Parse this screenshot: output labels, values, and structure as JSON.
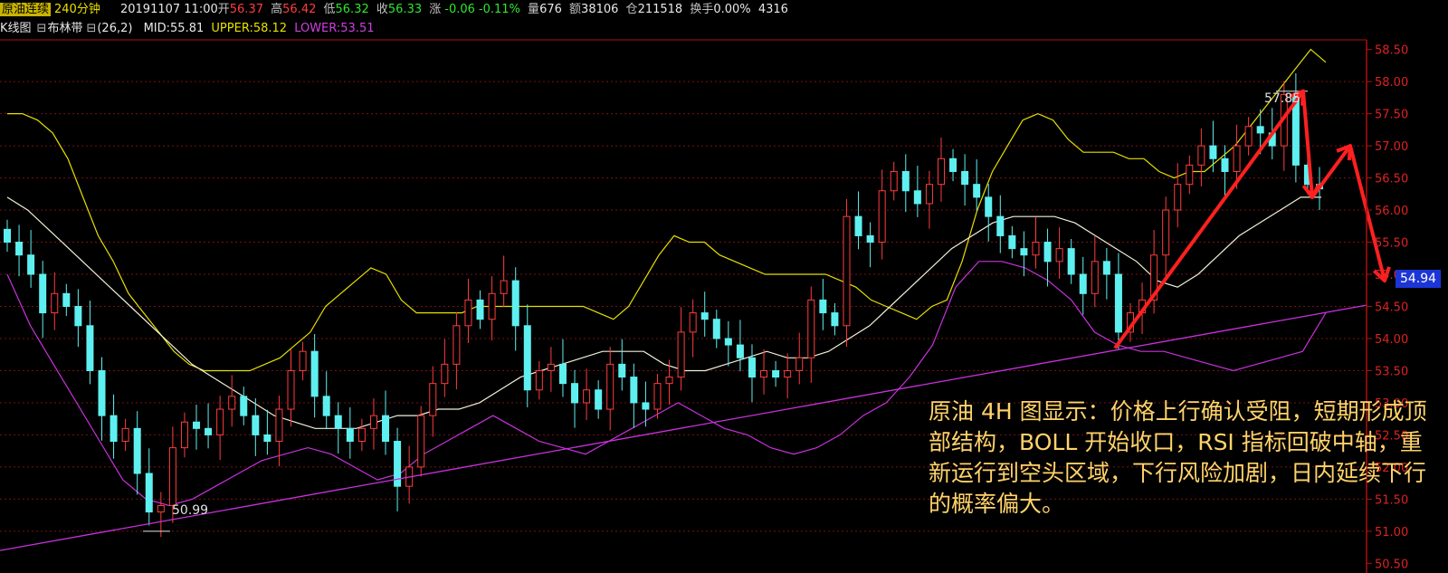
{
  "header": {
    "instrument": "原油连续",
    "period": "240分钟",
    "datetime": "20191107 11:00",
    "open_label": "开",
    "open": "56.37",
    "high_label": "高",
    "high": "56.42",
    "low_label": "低",
    "low": "56.32",
    "close_label": "收",
    "close": "56.33",
    "change_label": "涨",
    "change": "-0.06",
    "change_pct": "-0.11%",
    "volume_label": "量",
    "volume": "676",
    "amount_label": "额",
    "amount": "38106",
    "oi_label": "仓",
    "oi": "211518",
    "turnover_label": "换手",
    "turnover": "0.00%",
    "extra": "4316"
  },
  "indicator_bar": {
    "kline": "K线图",
    "boll_name": "布林带",
    "params": "(26,2)",
    "mid": "MID:55.81",
    "upper": "UPPER:58.12",
    "lower": "LOWER:53.51",
    "icon_box": "⊟"
  },
  "colors": {
    "up": "#ff3c3c",
    "down": "#5ef0f0",
    "mid": "#f0f0d8",
    "upper": "#e6e000",
    "lower": "#c832dc",
    "grid": "#7a1010",
    "axis": "#b01010",
    "arrow": "#ff2020",
    "annotation": "#ffd36a"
  },
  "annotation": {
    "text": "原油 4H 图显示：价格上行确认受阻，短期形成顶部结构，BOLL 开始收口，RSI 指标回破中轴，重新运行到空头区域，下行风险加剧，日内延续下行的概率偏大。"
  },
  "price_tag": "54.94",
  "chart_data": {
    "type": "candlestick",
    "title": "原油连续 240分钟",
    "y_axis_ticks": [
      "58.50",
      "58.00",
      "57.50",
      "57.00",
      "56.50",
      "56.00",
      "55.50",
      "55.00",
      "54.50",
      "54.00",
      "53.50",
      "53.00",
      "52.50",
      "52.00",
      "51.50",
      "51.00",
      "50.50"
    ],
    "ylim": [
      50.35,
      58.65
    ],
    "low_marker": "50.99",
    "high_marker": "57.85",
    "current_price": "54.94",
    "indicator": {
      "name": "BOLL",
      "params": "(26,2)",
      "MID": 55.81,
      "UPPER": 58.12,
      "LOWER": 53.51
    },
    "close_path": [
      55.5,
      55.3,
      55.0,
      54.4,
      54.7,
      54.5,
      54.2,
      53.5,
      52.8,
      52.4,
      52.6,
      51.9,
      51.3,
      51.4,
      52.3,
      52.7,
      52.6,
      52.5,
      52.9,
      53.1,
      52.8,
      52.5,
      52.4,
      52.9,
      53.5,
      53.8,
      53.1,
      52.8,
      52.6,
      52.4,
      52.6,
      52.8,
      52.4,
      51.7,
      52.0,
      52.8,
      53.3,
      53.6,
      54.2,
      54.6,
      54.3,
      54.7,
      54.9,
      54.2,
      53.2,
      53.5,
      53.6,
      53.3,
      53.0,
      53.2,
      52.9,
      53.6,
      53.4,
      53.0,
      52.9,
      53.3,
      53.4,
      54.1,
      54.4,
      54.3,
      54.0,
      53.9,
      53.7,
      53.4,
      53.5,
      53.4,
      53.5,
      53.7,
      54.6,
      54.4,
      54.2,
      55.9,
      55.6,
      55.5,
      56.3,
      56.6,
      56.3,
      56.1,
      56.4,
      56.8,
      56.6,
      56.4,
      56.2,
      55.9,
      55.6,
      55.4,
      55.3,
      55.5,
      55.2,
      55.4,
      55.0,
      54.7,
      55.2,
      55.0,
      54.1,
      54.4,
      54.6,
      55.3,
      56.0,
      56.4,
      56.7,
      57.0,
      56.8,
      56.6,
      57.0,
      57.3,
      57.2,
      57.0,
      57.8,
      56.7,
      56.4,
      56.33
    ],
    "upper_band": [
      57.5,
      57.5,
      57.4,
      57.2,
      56.8,
      56.2,
      55.6,
      55.2,
      54.7,
      54.4,
      54.1,
      53.8,
      53.6,
      53.5,
      53.5,
      53.5,
      53.5,
      53.6,
      53.7,
      53.9,
      54.1,
      54.5,
      54.7,
      54.9,
      55.1,
      55.0,
      54.6,
      54.4,
      54.4,
      54.4,
      54.4,
      54.5,
      54.5,
      54.5,
      54.5,
      54.5,
      54.5,
      54.5,
      54.5,
      54.4,
      54.3,
      54.5,
      54.9,
      55.3,
      55.6,
      55.5,
      55.5,
      55.3,
      55.2,
      55.1,
      55.0,
      55.0,
      55.0,
      55.0,
      55.0,
      54.9,
      54.8,
      54.6,
      54.5,
      54.4,
      54.3,
      54.5,
      54.6,
      55.2,
      56.0,
      56.6,
      57.0,
      57.4,
      57.5,
      57.4,
      57.1,
      56.9,
      56.9,
      56.9,
      56.8,
      56.8,
      56.6,
      56.5,
      56.6,
      56.6,
      56.8,
      57.0,
      57.3,
      57.6,
      57.9,
      58.2,
      58.5,
      58.3
    ],
    "mid_band": [
      56.2,
      56.0,
      55.7,
      55.4,
      55.1,
      54.8,
      54.5,
      54.2,
      53.9,
      53.6,
      53.4,
      53.2,
      53.0,
      52.8,
      52.7,
      52.6,
      52.6,
      52.6,
      52.7,
      52.8,
      52.8,
      52.9,
      52.9,
      53.0,
      53.2,
      53.4,
      53.5,
      53.6,
      53.7,
      53.8,
      53.8,
      53.8,
      53.6,
      53.5,
      53.5,
      53.6,
      53.7,
      53.8,
      53.7,
      53.7,
      53.8,
      54.0,
      54.2,
      54.5,
      54.8,
      55.1,
      55.4,
      55.6,
      55.8,
      55.9,
      55.9,
      55.9,
      55.8,
      55.6,
      55.4,
      55.2,
      54.9,
      54.8,
      55.0,
      55.3,
      55.6,
      55.8,
      56.0,
      56.2,
      56.2
    ],
    "lower_band": [
      55.0,
      54.2,
      53.6,
      53.0,
      52.4,
      51.8,
      51.5,
      51.4,
      51.5,
      51.7,
      51.9,
      52.1,
      52.2,
      52.3,
      52.2,
      52.0,
      51.8,
      51.9,
      52.2,
      52.4,
      52.6,
      52.8,
      52.6,
      52.4,
      52.3,
      52.2,
      52.4,
      52.6,
      52.8,
      53.0,
      52.8,
      52.6,
      52.5,
      52.3,
      52.2,
      52.3,
      52.5,
      52.8,
      53.0,
      53.4,
      53.9,
      54.8,
      55.2,
      55.2,
      55.1,
      54.9,
      54.6,
      54.1,
      53.9,
      53.8,
      53.8,
      53.7,
      53.6,
      53.5,
      53.6,
      53.7,
      53.8,
      54.4
    ],
    "support_line": {
      "from": [
        0,
        50.7
      ],
      "to": [
        1510,
        54.52
      ]
    },
    "arrows": [
      "up: 53.85 -> 57.85",
      "down: 57.85 -> 56.2",
      "up: 56.2 -> 57.0",
      "down: 57.0 -> 54.9"
    ]
  }
}
